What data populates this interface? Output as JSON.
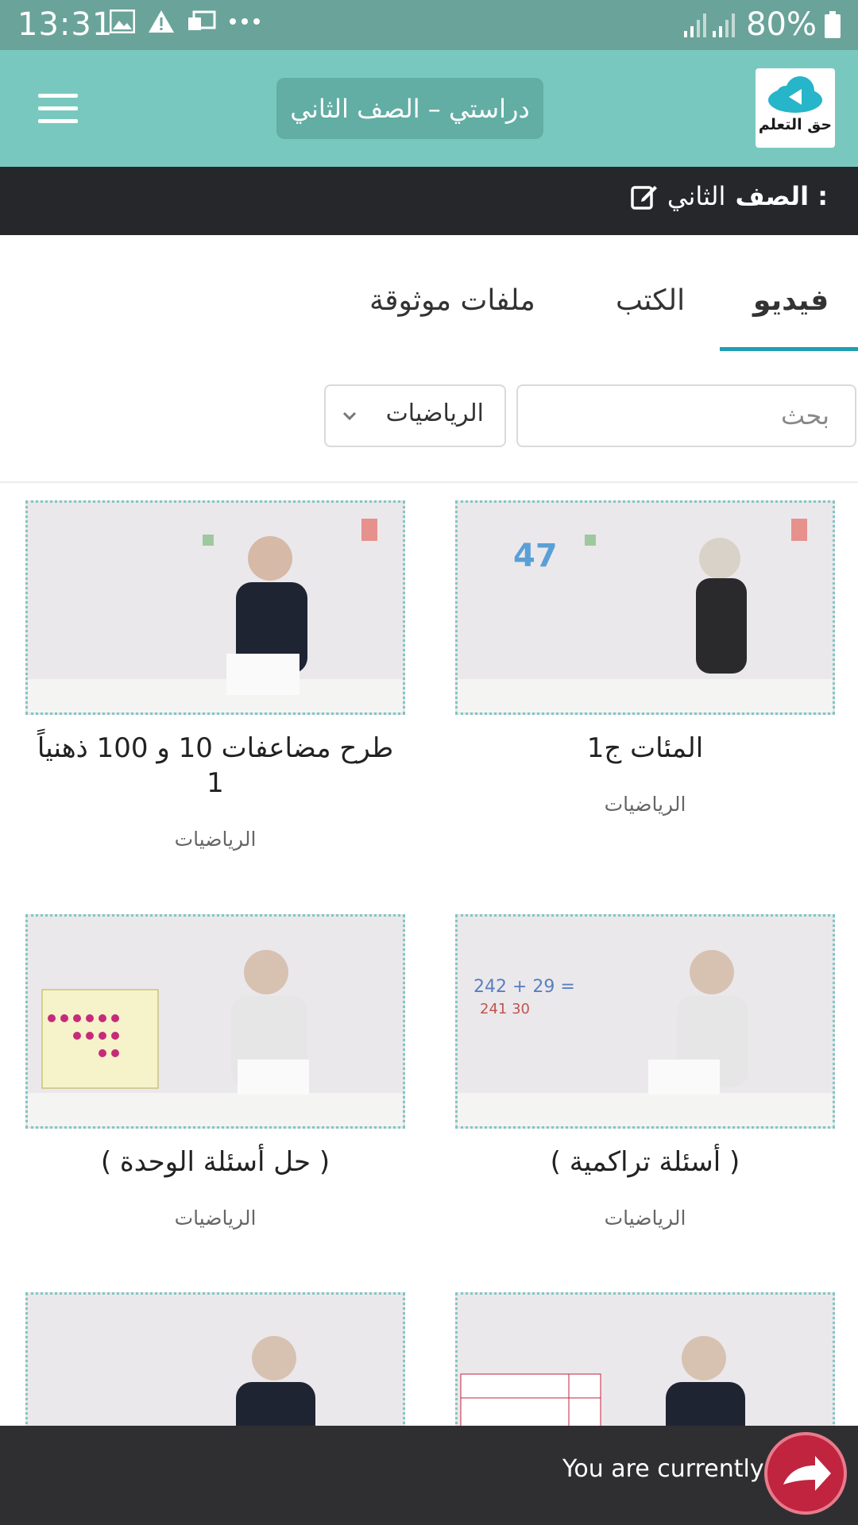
{
  "status_bar": {
    "time": "13:31",
    "battery": "80%",
    "icons": [
      "image-icon",
      "warning-icon",
      "mail-icon",
      "more-icon",
      "signal-icon",
      "battery-icon"
    ]
  },
  "app_bar": {
    "logo_text": "حق التعلم",
    "title": "دراستي – الصف الثاني",
    "menu_icon": "hamburger-icon",
    "accent_color": "#79c8bf"
  },
  "grade": {
    "label": "الصف :",
    "value": "الثاني",
    "edit_icon": "edit-icon"
  },
  "tabs": [
    {
      "label": "فيديو",
      "active": true
    },
    {
      "label": "الكتب",
      "active": false
    },
    {
      "label": "ملفات موثوقة",
      "active": false
    }
  ],
  "search": {
    "placeholder": "بحث"
  },
  "subject_filter": {
    "selected": "الرياضيات"
  },
  "videos": [
    {
      "title": "المئات ج1",
      "subject": "الرياضيات"
    },
    {
      "title": "طرح مضاعفات 10 و 100 ذهنياً 1",
      "subject": "الرياضيات"
    },
    {
      "title": "( أسئلة تراكمية )",
      "subject": "الرياضيات"
    },
    {
      "title": "( حل أسئلة الوحدة )",
      "subject": "الرياضيات"
    },
    {
      "title": "",
      "subject": ""
    },
    {
      "title": "",
      "subject": ""
    }
  ],
  "banner": {
    "text": "You are currently o"
  }
}
